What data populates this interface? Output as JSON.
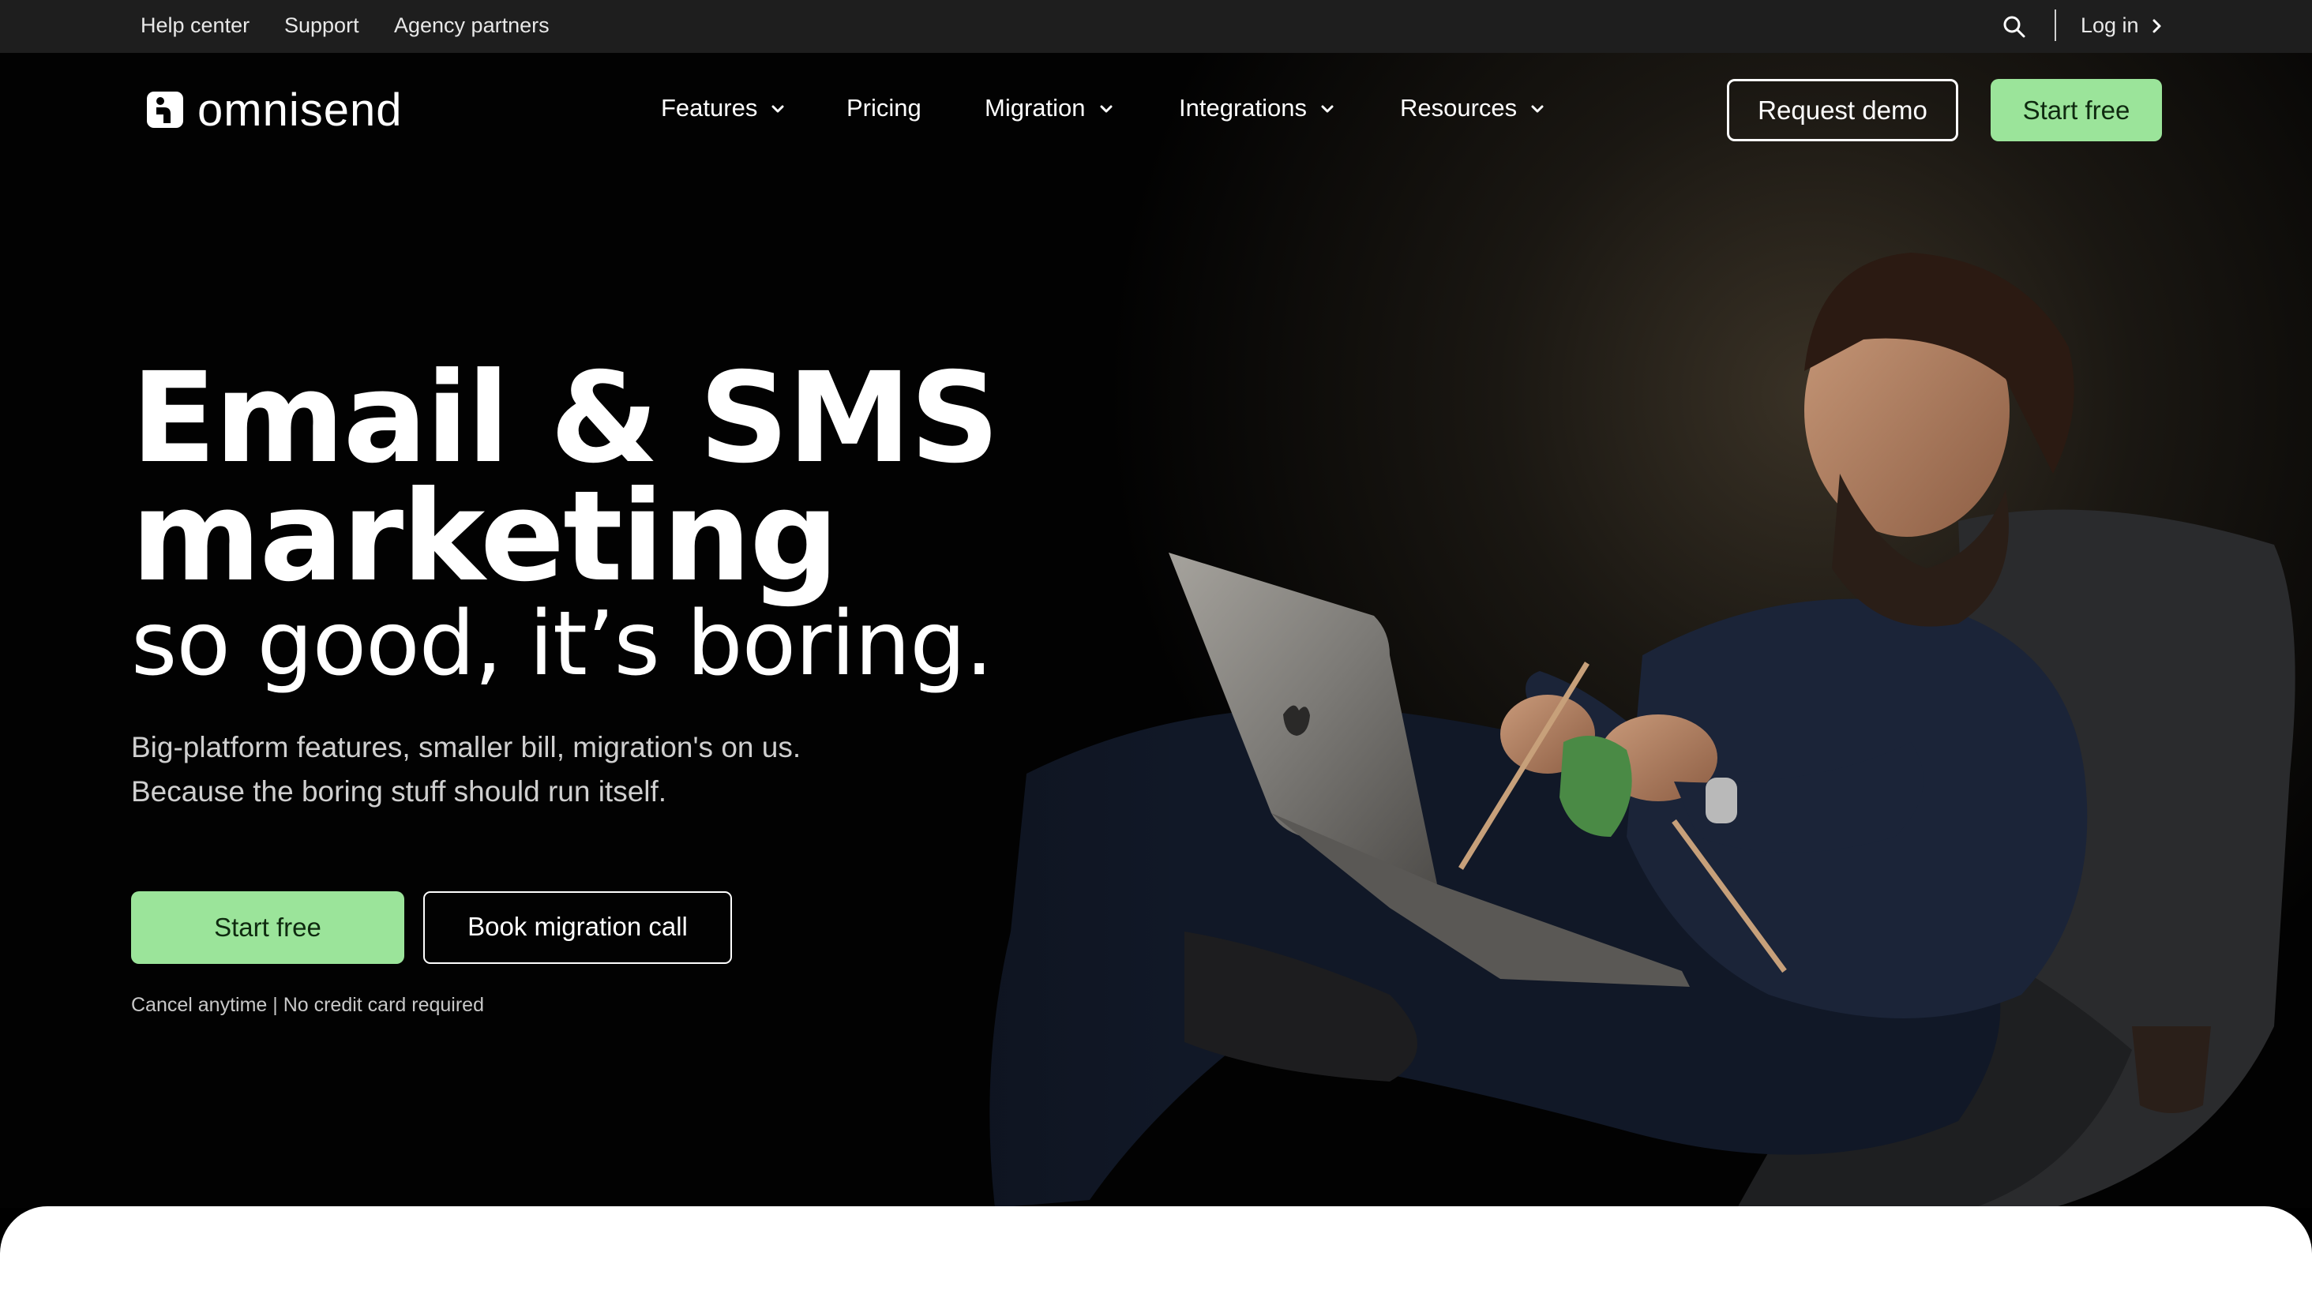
{
  "utility_bar": {
    "links": [
      "Help center",
      "Support",
      "Agency partners"
    ],
    "search_icon": "search-icon",
    "login_label": "Log in",
    "login_icon": "chevron-right-icon"
  },
  "nav": {
    "brand": "omnisend",
    "items": [
      {
        "label": "Features",
        "has_dropdown": true
      },
      {
        "label": "Pricing",
        "has_dropdown": false
      },
      {
        "label": "Migration",
        "has_dropdown": true
      },
      {
        "label": "Integrations",
        "has_dropdown": true
      },
      {
        "label": "Resources",
        "has_dropdown": true
      }
    ],
    "request_demo_label": "Request demo",
    "start_free_label": "Start free"
  },
  "hero": {
    "headline_line1": "Email & SMS",
    "headline_line2": "marketing",
    "subheadline": "so good, it’s boring.",
    "lead_line1": "Big-platform features, smaller bill, migration's on us.",
    "lead_line2": "Because the boring stuff should run itself.",
    "cta_primary": "Start free",
    "cta_secondary": "Book migration call",
    "fineprint": "Cancel anytime | No credit card required"
  },
  "colors": {
    "accent_green": "#9be49a",
    "utility_bar_bg": "#1e1e1e",
    "page_bg": "#000000"
  }
}
